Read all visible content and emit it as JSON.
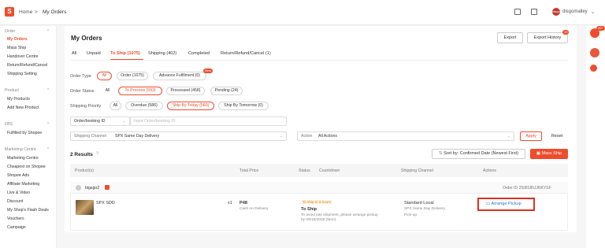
{
  "header": {
    "breadcrumb_home": "Home",
    "breadcrumb_sep": ">",
    "breadcrumb_current": "My Orders",
    "username": "disgomalley",
    "avatar_text": "disgo"
  },
  "sidebar": {
    "sections": [
      {
        "title": "Order",
        "items": [
          "My Orders",
          "Mass Ship",
          "Handover Centre",
          "Return/Refund/Cancel",
          "Shipping Setting"
        ]
      },
      {
        "title": "Product",
        "items": [
          "My Products",
          "Add New Product"
        ]
      },
      {
        "title": "FBS",
        "items": [
          "Fulfilled by Shopee"
        ]
      },
      {
        "title": "Marketing Centre",
        "items": [
          "Marketing Centre",
          "Cheapest on Shopee",
          "Shopee Ads",
          "Affiliate Marketing",
          "Live & Video",
          "Discount",
          "My Shop's Flash Deals",
          "Vouchers",
          "Campaign"
        ]
      }
    ]
  },
  "main": {
    "title": "My Orders",
    "export_label": "Export",
    "export_history_label": "Export History",
    "export_history_badge": "10",
    "tabs": [
      "All",
      "Unpaid",
      "To Ship (1075)",
      "Shipping (402)",
      "Completed",
      "Return/Refund/Cancel (1)"
    ],
    "order_type": {
      "label": "Order Type",
      "options": [
        "All",
        "Order (1075)",
        "Advance Fulfilment (0)"
      ],
      "new_badge": "New"
    },
    "order_status": {
      "label": "Order Status",
      "options": [
        "All",
        "To Process (593)",
        "Processed (458)",
        "Pending (24)"
      ]
    },
    "shipping_priority": {
      "label": "Shipping Priority",
      "options": [
        "All",
        "Overdue (586)",
        "Ship By Today (580)",
        "Ship By Tomorrow (0)"
      ]
    },
    "search": {
      "select_value": "Order/booking ID",
      "placeholder": "Input Order/booking ID"
    },
    "shipping_channel": {
      "label": "Shipping Channel",
      "value": "SPX Same Day Delivery"
    },
    "action": {
      "label": "Action",
      "value": "All Actions"
    },
    "apply_label": "Apply",
    "reset_label": "Reset",
    "results_text": "2 Results",
    "sort_label": "Sort by: Confirmed Date (Newest First)",
    "mass_ship_label": "Mass Ship",
    "columns": [
      "Product(s)",
      "Total Price",
      "Status",
      "Countdown",
      "Shipping Channel",
      "Actions"
    ],
    "order": {
      "buyer": "bigsgo2",
      "order_id": "Order ID 2508185JJRKYSF",
      "product_name": "SPX SDD",
      "qty": "x1",
      "price": "P48",
      "payment": "Cash on Delivery",
      "countdown_tag": "To ship in 3 hours",
      "status": "To Ship",
      "status_note": "To avoid late shipment, please arrange pickup by 08/18/2025 (Mon).",
      "channel": "Standard Local",
      "channel_sub": "SPX Same Day Delivery",
      "channel_sub2": "Pick-up",
      "arrange_label": "Arrange Pickup"
    }
  },
  "rail": {
    "badge": "99+"
  },
  "colors": {
    "accent": "#ee4d2d",
    "highlight_box": "#e0301e"
  },
  "icons": [
    "shopee-logo-icon",
    "grid-icon",
    "book-icon",
    "chevron-down-icon",
    "chat-icon",
    "help-icon",
    "truck-icon",
    "sort-icon",
    "calendar-icon"
  ]
}
